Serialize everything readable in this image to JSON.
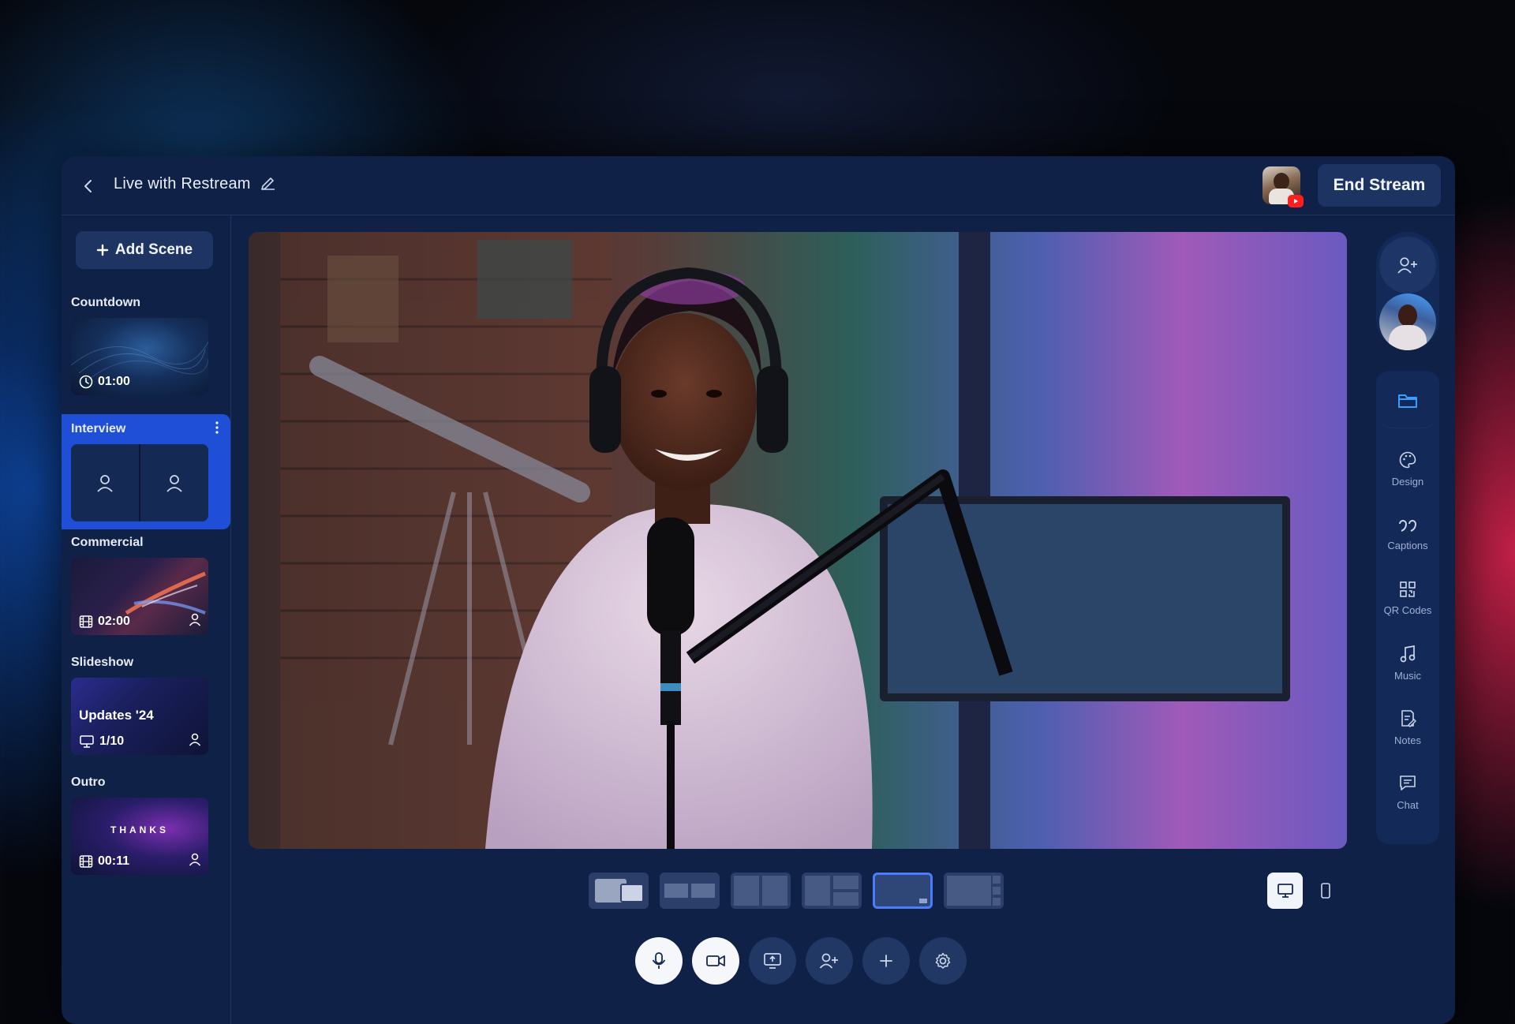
{
  "header": {
    "title": "Live with Restream",
    "end_stream_label": "End Stream"
  },
  "sidebar": {
    "add_scene_label": "Add Scene",
    "scenes": [
      {
        "label": "Countdown",
        "badge": "01:00"
      },
      {
        "label": "Interview"
      },
      {
        "label": "Commercial",
        "badge": "02:00"
      },
      {
        "label": "Slideshow",
        "slide_title": "Updates '24",
        "badge": "1/10"
      },
      {
        "label": "Outro",
        "thumb_text": "THANKS",
        "badge": "00:11"
      }
    ]
  },
  "tools": {
    "items": [
      {
        "label": "Design",
        "icon": "palette-icon"
      },
      {
        "label": "Captions",
        "icon": "quote-icon"
      },
      {
        "label": "QR Codes",
        "icon": "qr-icon"
      },
      {
        "label": "Music",
        "icon": "music-icon"
      },
      {
        "label": "Notes",
        "icon": "notes-icon"
      },
      {
        "label": "Chat",
        "icon": "chat-icon"
      }
    ]
  },
  "colors": {
    "app_bg": "#0f2147",
    "accent": "#1f4fd6",
    "selected_outline": "#4a7cff",
    "youtube_red": "#ff1e1e",
    "glow_blue": "#146eff",
    "glow_pink": "#ff285a"
  }
}
